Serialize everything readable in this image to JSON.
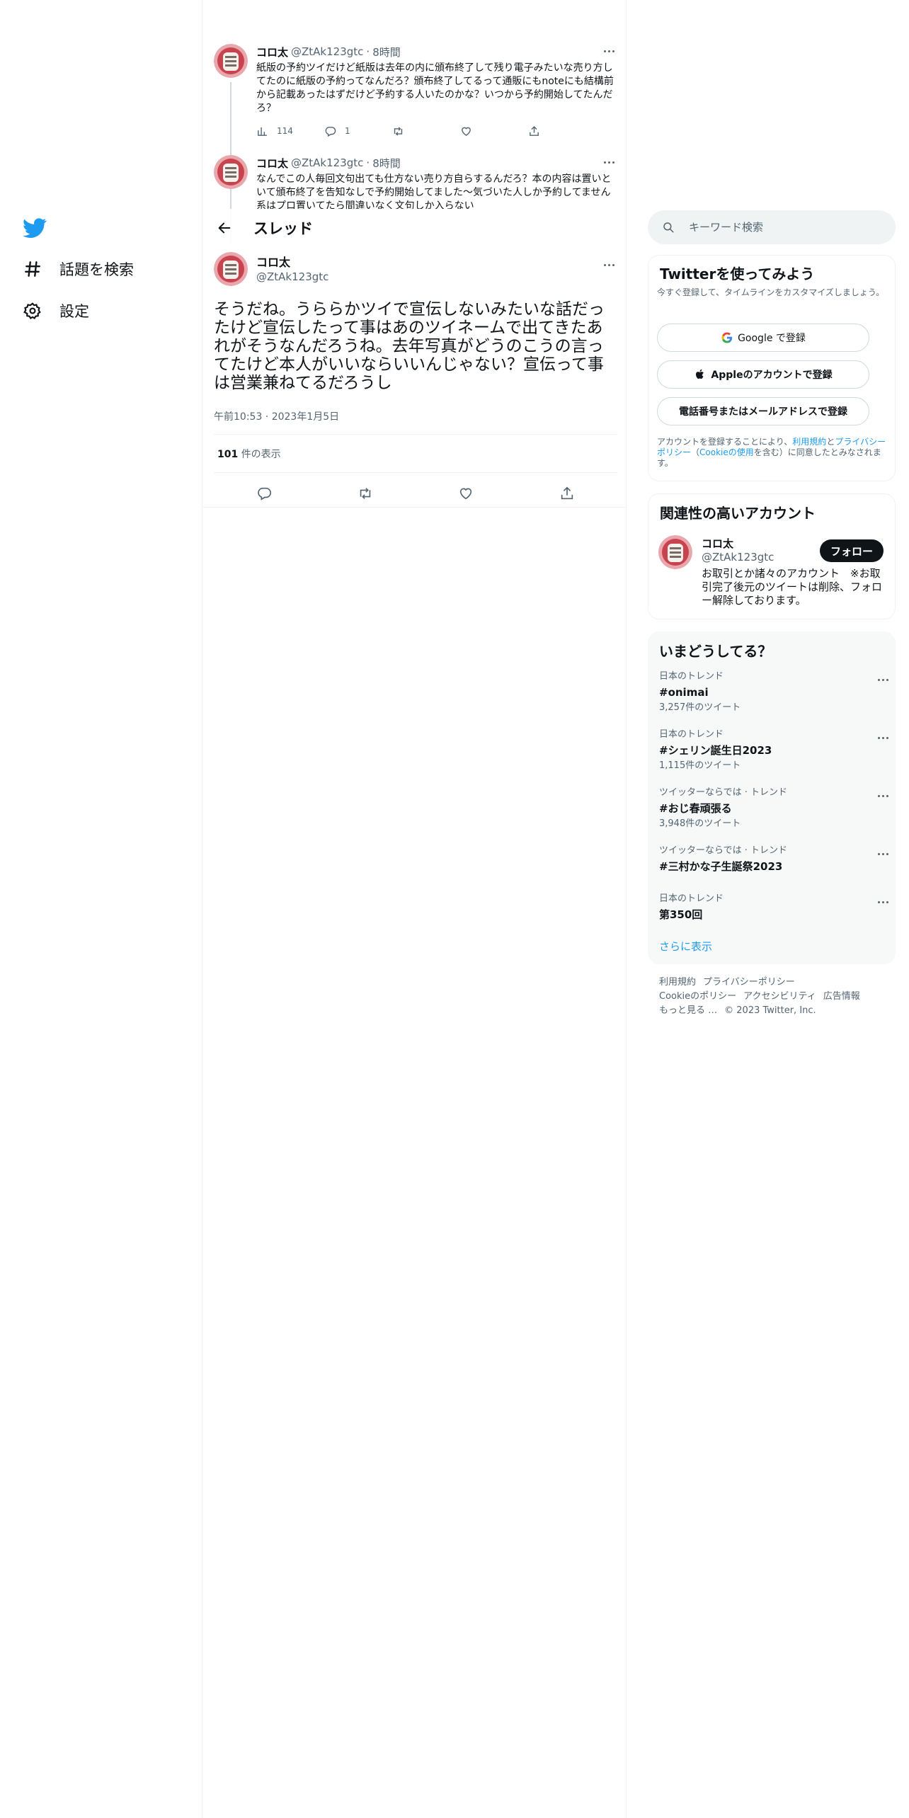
{
  "nav": {
    "items": [
      {
        "label": "話題を検索",
        "icon": "hashtag-icon"
      },
      {
        "label": "設定",
        "icon": "gear-icon"
      }
    ]
  },
  "context_tweets": [
    {
      "name": "コロ太",
      "handle": "@ZtAk123gtc",
      "dot": "·",
      "time": "8時間",
      "text": "紙版の予約ツイだけど紙版は去年の内に頒布終了して残り電子みたいな売り方してたのに紙版の予約ってなんだろ？頒布終了してるって通販にもnoteにも結構前から記載あったはずだけど予約する人いたのかな？いつから予約開始してたんだろ？",
      "views": "114",
      "replies": "1"
    },
    {
      "name": "コロ太",
      "handle": "@ZtAk123gtc",
      "dot": "·",
      "time": "8時間",
      "text": "なんでこの人毎回文句出ても仕方ない売り方自らするんだろ？本の内容は置いといて頒布終了を告知なしで予約開始してました～気づいた人しか予約してません系はプロ置いてたら間違いなく文句しか入らない"
    }
  ],
  "thread_header": {
    "title": "スレッド"
  },
  "focal_tweet": {
    "name": "コロ太",
    "handle": "@ZtAk123gtc",
    "text": "そうだね。うららかツイで宣伝しないみたいな話だったけど宣伝したって事はあのツイネームで出てきたあれがそうなんだろうね。去年写真がどうのこうの言ってたけど本人がいいならいいんじゃない？宣伝って事は営業兼ねてるだろうし",
    "timestamp": "午前10:53 · 2023年1月5日",
    "views_count": "101",
    "views_label": "件の表示"
  },
  "search": {
    "placeholder": "キーワード検索"
  },
  "signup": {
    "title": "Twitterを使ってみよう",
    "subtitle": "今すぐ登録して、タイムラインをカスタマイズしましょう。",
    "google_label": "Google で登録",
    "apple_label": "Appleのアカウントで登録",
    "phone_label": "電話番号またはメールアドレスで登録",
    "terms_prefix": "アカウントを登録することにより、",
    "terms_link": "利用規約",
    "terms_and": "と",
    "privacy_link": "プライバシーポリシー",
    "cookie_open": "（",
    "cookie_link": "Cookieの使用",
    "cookie_close": "を含む）に同意したとみなされます。"
  },
  "related": {
    "title": "関連性の高いアカウント",
    "name": "コロ太",
    "handle": "@ZtAk123gtc",
    "follow_label": "フォロー",
    "bio": "お取引とか諸々のアカウント　※お取引完了後元のツイートは削除、フォロー解除しております。"
  },
  "trends": {
    "title": "いまどうしてる？",
    "items": [
      {
        "context": "日本のトレンド",
        "name": "#onimai",
        "count": "3,257件のツイート"
      },
      {
        "context": "日本のトレンド",
        "name": "#シェリン誕生日2023",
        "count": "1,115件のツイート"
      },
      {
        "context": "ツイッターならでは · トレンド",
        "name": "#おじ春頑張る",
        "count": "3,948件のツイート"
      },
      {
        "context": "ツイッターならでは · トレンド",
        "name": "#三村かな子生誕祭2023",
        "count": ""
      },
      {
        "context": "日本のトレンド",
        "name": "第350回",
        "count": ""
      }
    ],
    "show_more": "さらに表示"
  },
  "footer": {
    "terms": "利用規約",
    "privacy": "プライバシーポリシー",
    "cookie": "Cookieのポリシー",
    "accessibility": "アクセシビリティ",
    "ads": "広告情報",
    "more": "もっと見る …",
    "copyright": "© 2023 Twitter, Inc."
  },
  "colors": {
    "accent": "#1d9bf0",
    "text": "#0f1419",
    "muted": "#536471",
    "border": "#eff3f4"
  }
}
